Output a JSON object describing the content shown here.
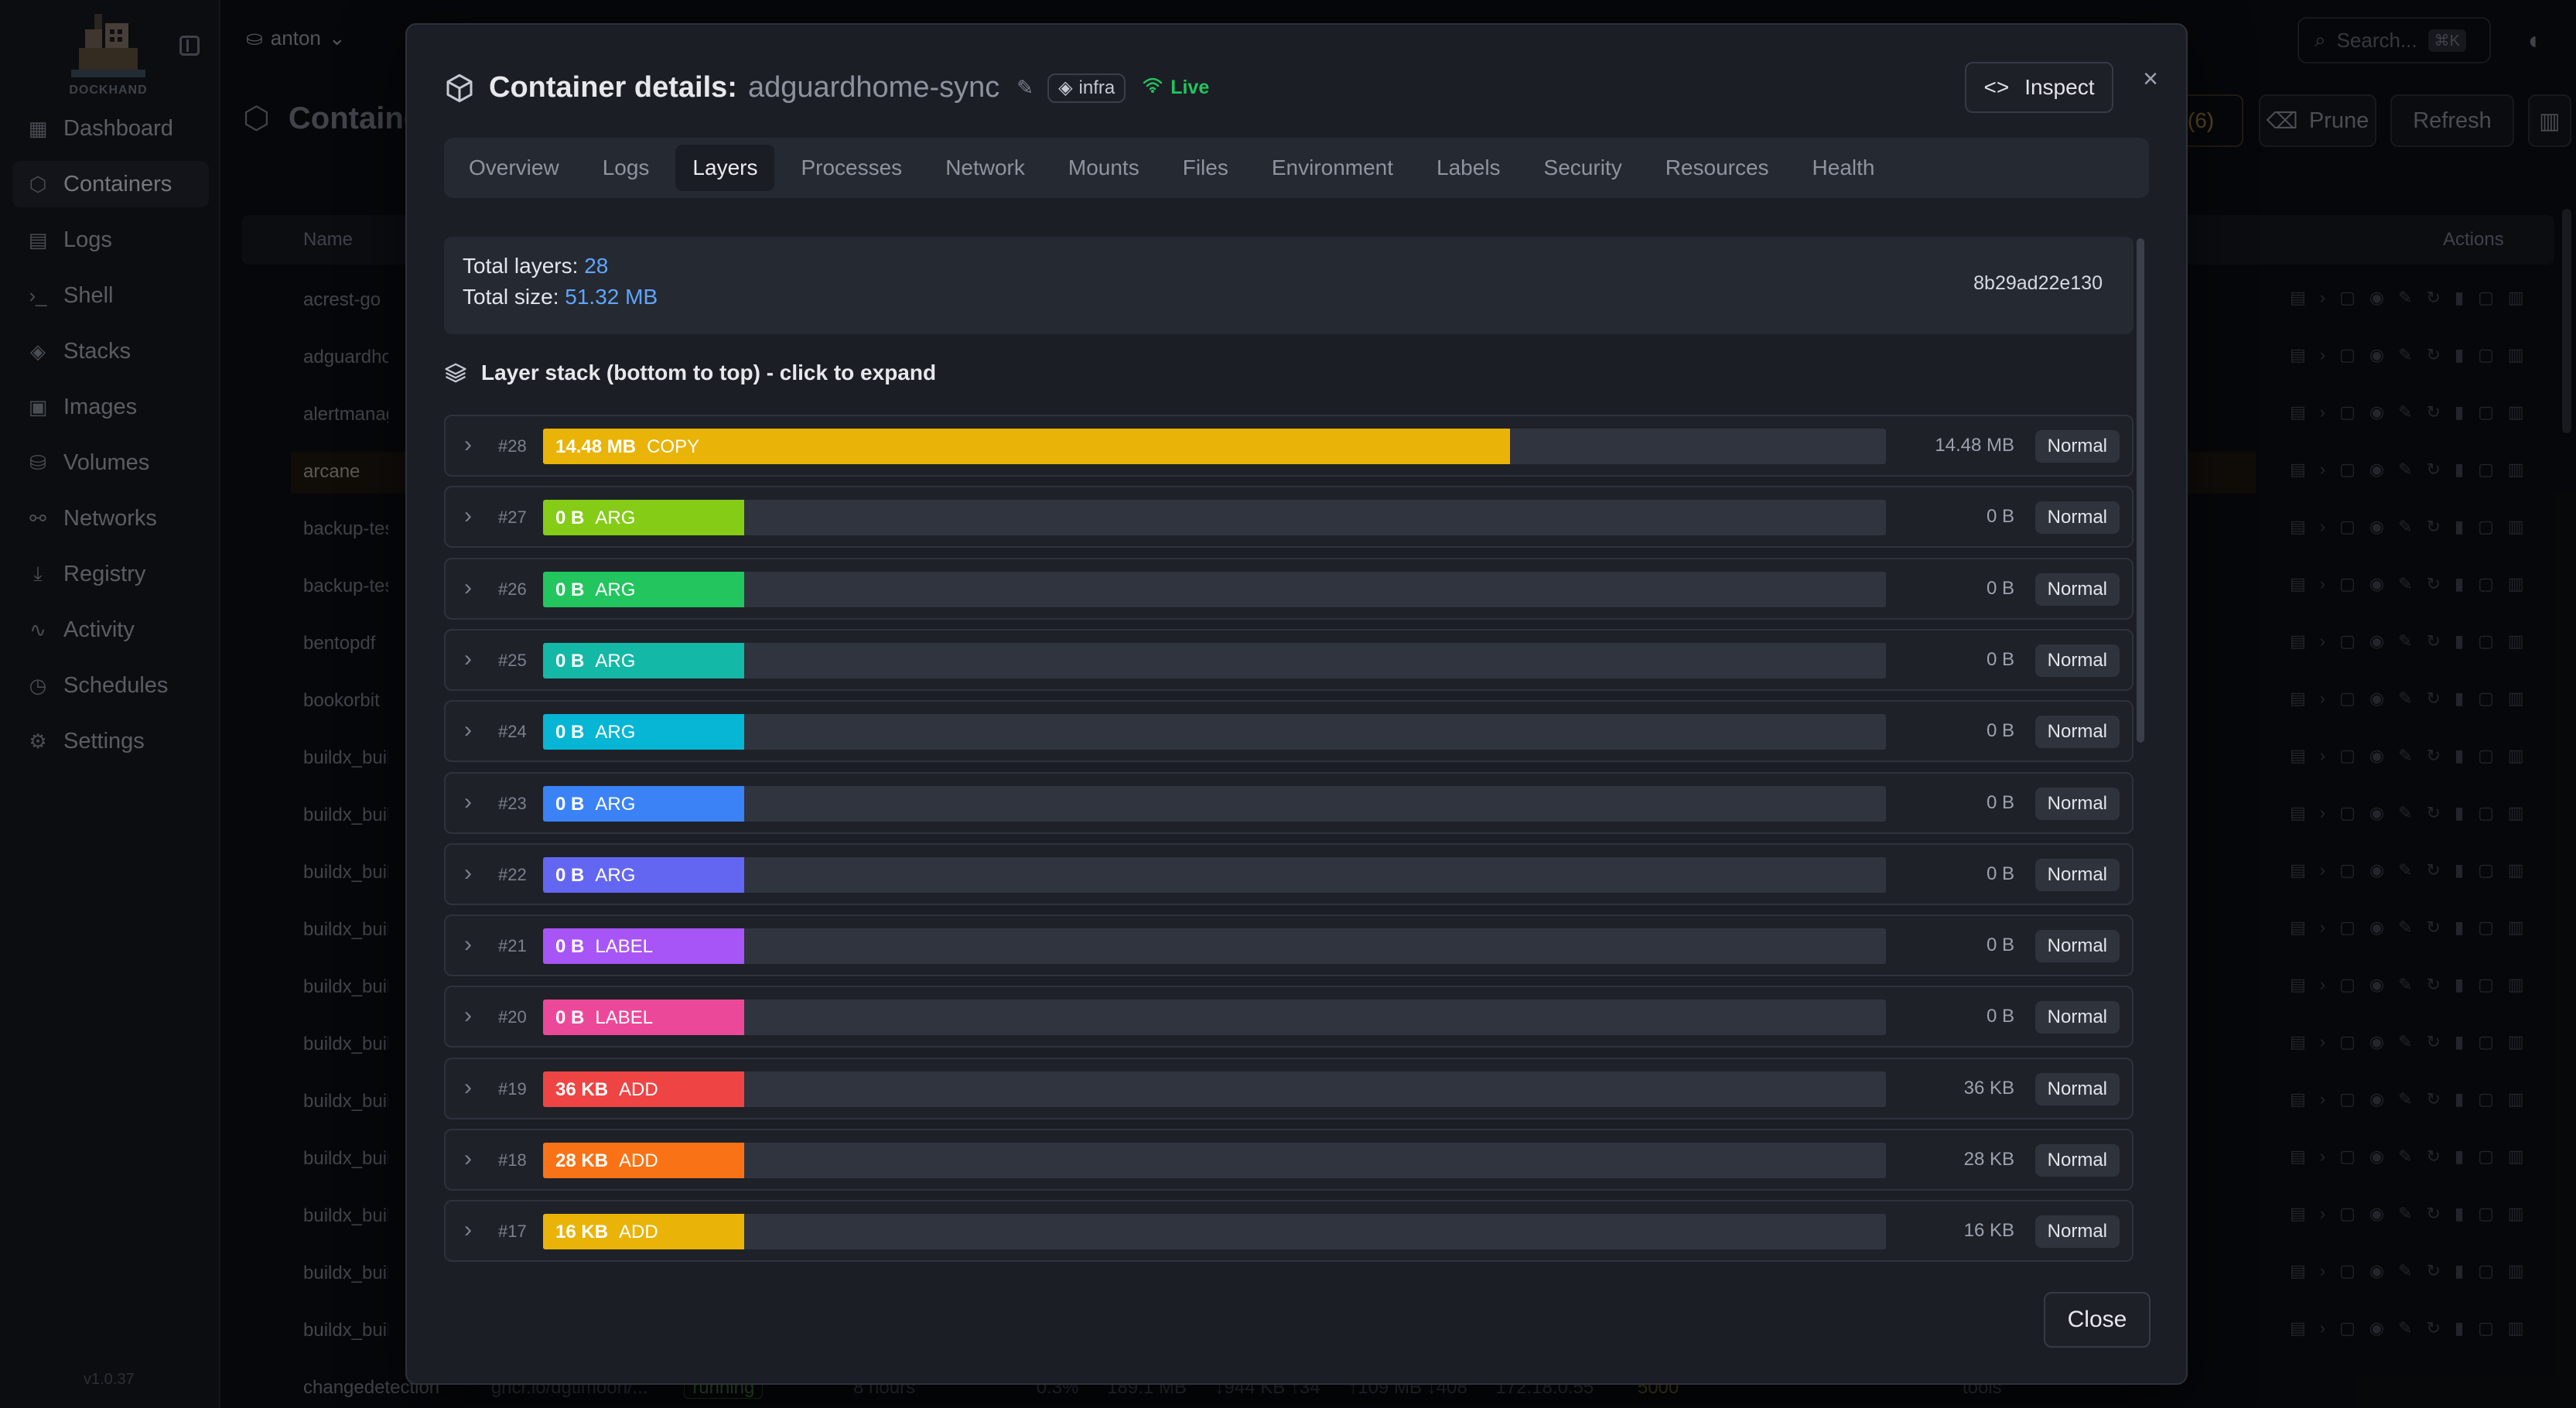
{
  "app": {
    "logo_text": "DOCKHAND",
    "version": "v1.0.37",
    "environment": "anton",
    "search_placeholder": "Search...",
    "search_shortcut": "⌘K",
    "page_title": "Containers",
    "updates_badge": "(6)",
    "prune_label": "Prune",
    "refresh_label": "Refresh"
  },
  "sidebar": {
    "items": [
      {
        "label": "Dashboard",
        "icon": "grid-icon"
      },
      {
        "label": "Containers",
        "icon": "box-icon"
      },
      {
        "label": "Logs",
        "icon": "scroll-icon"
      },
      {
        "label": "Shell",
        "icon": "terminal-icon"
      },
      {
        "label": "Stacks",
        "icon": "layers-icon"
      },
      {
        "label": "Images",
        "icon": "images-icon"
      },
      {
        "label": "Volumes",
        "icon": "drive-icon"
      },
      {
        "label": "Networks",
        "icon": "network-icon"
      },
      {
        "label": "Registry",
        "icon": "download-icon"
      },
      {
        "label": "Activity",
        "icon": "activity-icon"
      },
      {
        "label": "Schedules",
        "icon": "timer-icon"
      },
      {
        "label": "Settings",
        "icon": "gear-icon"
      }
    ]
  },
  "table": {
    "col_name": "Name",
    "col_actions": "Actions",
    "rows": [
      "acrest-go",
      "adguardhom",
      "alertmanage",
      "arcane",
      "backup-test",
      "backup-test",
      "bentopdf",
      "bookorbit",
      "buildx_build",
      "buildx_build",
      "buildx_build",
      "buildx_build",
      "buildx_build",
      "buildx_build",
      "buildx_build",
      "buildx_build",
      "buildx_build",
      "buildx_build",
      "buildx_build"
    ],
    "last_row": {
      "name": "changedetection",
      "image": "ghcr.io/dgtlmoon/...",
      "status": "running",
      "uptime": "8 hours",
      "cpu": "0.3%",
      "mem": "189.1 MB",
      "net": "↓944 KB ↑34",
      "io": "↑109 MB ↓408",
      "ip": "172.18.0.55",
      "port": "5000",
      "stack": "tools"
    }
  },
  "modal": {
    "title": "Container details:",
    "container_name": "adguardhome-sync",
    "tag": "infra",
    "live_label": "Live",
    "inspect_label": "Inspect",
    "close_label": "Close",
    "tabs": [
      "Overview",
      "Logs",
      "Layers",
      "Processes",
      "Network",
      "Mounts",
      "Files",
      "Environment",
      "Labels",
      "Security",
      "Resources",
      "Health"
    ],
    "active_tab": "Layers",
    "summary": {
      "layers_label": "Total layers:",
      "layers_value": "28",
      "size_label": "Total size:",
      "size_value": "51.32 MB",
      "image_id": "8b29ad22e130"
    },
    "stack_title": "Layer stack (bottom to top) - click to expand",
    "layers": [
      {
        "num": "#28",
        "size": "14.48 MB",
        "kind": "COPY",
        "type": "Normal",
        "color": "#eab308",
        "fill_fraction": 0.72
      },
      {
        "num": "#27",
        "size": "0 B",
        "kind": "ARG",
        "type": "Normal",
        "color": "#84cc16",
        "fill_fraction": 0.15
      },
      {
        "num": "#26",
        "size": "0 B",
        "kind": "ARG",
        "type": "Normal",
        "color": "#22c55e",
        "fill_fraction": 0.15
      },
      {
        "num": "#25",
        "size": "0 B",
        "kind": "ARG",
        "type": "Normal",
        "color": "#14b8a6",
        "fill_fraction": 0.15
      },
      {
        "num": "#24",
        "size": "0 B",
        "kind": "ARG",
        "type": "Normal",
        "color": "#06b6d4",
        "fill_fraction": 0.15
      },
      {
        "num": "#23",
        "size": "0 B",
        "kind": "ARG",
        "type": "Normal",
        "color": "#3b82f6",
        "fill_fraction": 0.15
      },
      {
        "num": "#22",
        "size": "0 B",
        "kind": "ARG",
        "type": "Normal",
        "color": "#6366f1",
        "fill_fraction": 0.15
      },
      {
        "num": "#21",
        "size": "0 B",
        "kind": "LABEL",
        "type": "Normal",
        "color": "#a855f7",
        "fill_fraction": 0.15
      },
      {
        "num": "#20",
        "size": "0 B",
        "kind": "LABEL",
        "type": "Normal",
        "color": "#ec4899",
        "fill_fraction": 0.15
      },
      {
        "num": "#19",
        "size": "36 KB",
        "kind": "ADD",
        "type": "Normal",
        "color": "#ef4444",
        "fill_fraction": 0.15
      },
      {
        "num": "#18",
        "size": "28 KB",
        "kind": "ADD",
        "type": "Normal",
        "color": "#f97316",
        "fill_fraction": 0.15
      },
      {
        "num": "#17",
        "size": "16 KB",
        "kind": "ADD",
        "type": "Normal",
        "color": "#eab308",
        "fill_fraction": 0.15
      }
    ]
  }
}
